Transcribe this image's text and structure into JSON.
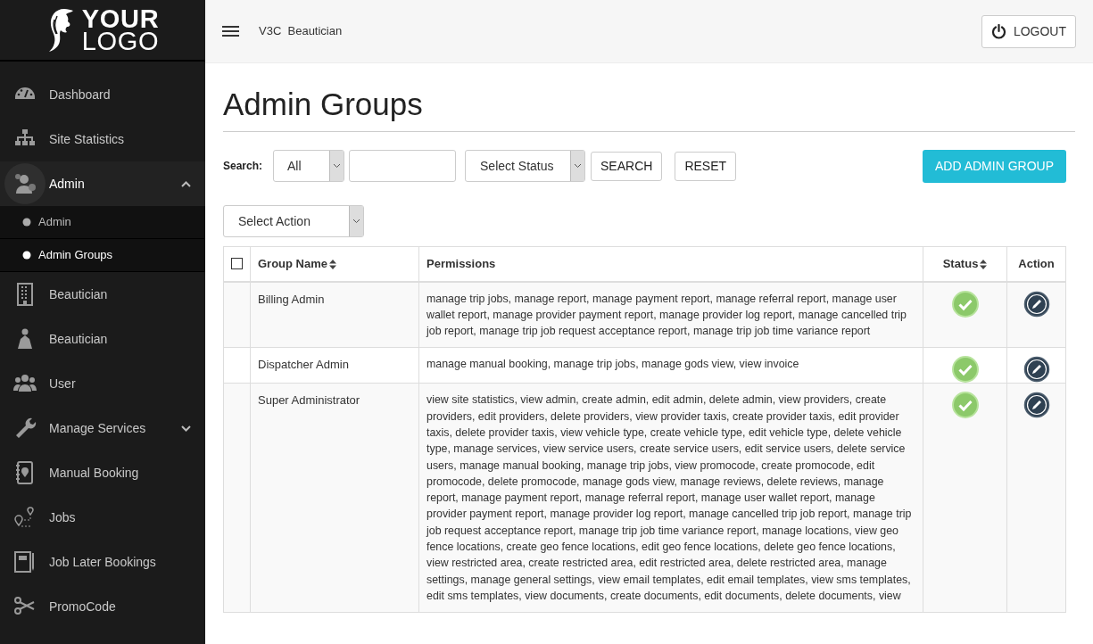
{
  "logo": {
    "line_1": "YOUR",
    "line_2": "LOGO"
  },
  "sidebar": {
    "items": [
      {
        "kind": "link",
        "label": "Dashboard",
        "selected": false
      },
      {
        "kind": "link",
        "label": "Site Statistics",
        "selected": false
      },
      {
        "kind": "group",
        "label": "Admin",
        "selected": true,
        "expanded": true,
        "children": [
          {
            "label": "Admin",
            "selected": false
          },
          {
            "label": "Admin Groups",
            "selected": true
          }
        ]
      },
      {
        "kind": "link",
        "label": "Beautician",
        "selected": false
      },
      {
        "kind": "link",
        "label": "Beautician",
        "selected": false
      },
      {
        "kind": "link",
        "label": "User",
        "selected": false
      },
      {
        "kind": "group",
        "label": "Manage Services",
        "selected": false,
        "expanded": false
      },
      {
        "kind": "link",
        "label": "Manual Booking",
        "selected": false
      },
      {
        "kind": "link",
        "label": "Jobs",
        "selected": false
      },
      {
        "kind": "link",
        "label": "Job Later Bookings",
        "selected": false
      },
      {
        "kind": "link",
        "label": "PromoCode",
        "selected": false
      }
    ]
  },
  "header": {
    "title": "V3C  Beautician",
    "logout": "LOGOUT"
  },
  "page_title": "Admin Groups",
  "filters": {
    "search_label": "Search:",
    "field_select": "All",
    "status_select": "Select Status",
    "search_button": "SEARCH",
    "reset_button": "RESET",
    "add_button": "ADD ADMIN GROUP",
    "action_select": "Select Action"
  },
  "table": {
    "columns": [
      "Group Name",
      "Permissions",
      "Status",
      "Action"
    ],
    "select_all": false,
    "rows": [
      {
        "name": "Billing Admin",
        "permissions": "manage trip jobs, manage report, manage payment report, manage referral report, manage user wallet report, manage provider payment report, manage provider log report, manage cancelled trip job report, manage trip job request acceptance report, manage trip job time variance report",
        "active": true
      },
      {
        "name": "Dispatcher Admin",
        "permissions": "manage manual booking, manage trip jobs, manage gods view, view invoice",
        "active": true
      },
      {
        "name": "Super Administrator",
        "permissions": "view site statistics, view admin, create admin, edit admin, delete admin, view providers, create providers, edit providers, delete providers, view provider taxis, create provider taxis, edit provider taxis, delete provider taxis, view vehicle type, create vehicle type, edit vehicle type, delete vehicle type, manage services, view service users, create service users, edit service users, delete service users, manage manual booking, manage trip jobs, view promocode, create promocode, edit promocode, delete promocode, manage gods view, manage reviews, delete reviews, manage report, manage payment report, manage referral report, manage user wallet report, manage provider payment report, manage provider log report, manage cancelled trip job report, manage trip job request acceptance report, manage trip job time variance report, manage locations, view geo fence locations, create geo fence locations, edit geo fence locations, delete geo fence locations, view restricted area, create restricted area, edit restricted area, delete restricted area, manage settings, manage general settings, view email templates, edit email templates, view sms templates, edit sms templates, view documents, create documents, edit documents, delete documents, view",
        "active": true
      }
    ]
  }
}
